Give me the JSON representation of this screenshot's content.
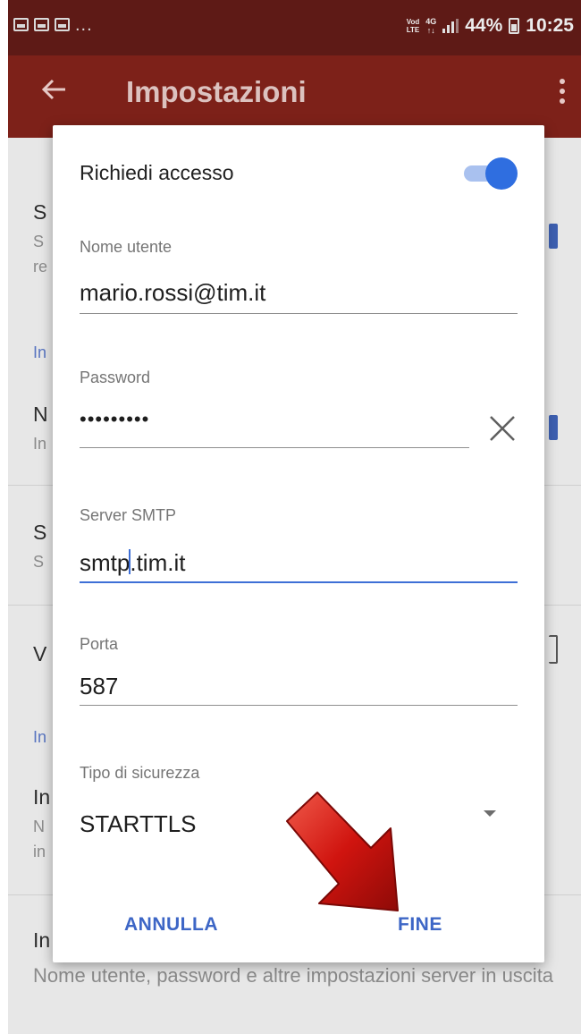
{
  "status_bar": {
    "volte_top": "Vod",
    "volte_bottom": "LTE",
    "net_top": "4G",
    "net_bottom": "↑↓",
    "battery": "44%",
    "time": "10:25",
    "left_overflow": "..."
  },
  "app_bar": {
    "title": "Impostazioni"
  },
  "background": {
    "bottom_text": "Nome utente, password e altre impostazioni server in uscita"
  },
  "dialog": {
    "toggle_label": "Richiedi accesso",
    "toggle_on": true,
    "username_label": "Nome utente",
    "username_value": "mario.rossi@tim.it",
    "password_label": "Password",
    "password_value": "•••••••••",
    "server_label": "Server SMTP",
    "server_value_before_cursor": "smtp",
    "server_value_after_cursor": ".tim.it",
    "port_label": "Porta",
    "port_value": "587",
    "security_label": "Tipo di sicurezza",
    "security_value": "STARTTLS",
    "cancel_label": "ANNULLA",
    "done_label": "FINE"
  },
  "colors": {
    "status_bar": "#5e1a16",
    "app_bar": "#7d2119",
    "accent": "#3d66c6",
    "toggle_knob": "#2f6ee0",
    "annotation_arrow": "#d0140f"
  }
}
